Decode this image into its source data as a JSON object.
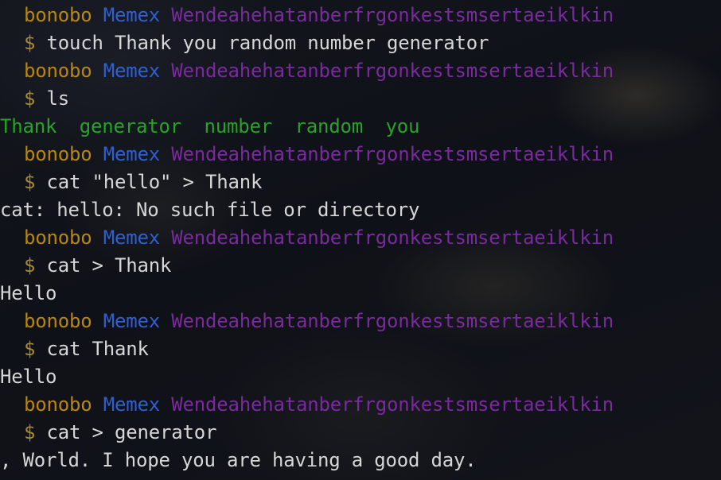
{
  "prompt": {
    "user": "bonobo",
    "host": "Memex",
    "path": "Wendeahehatanberfrgonkestsmsertaeiklkin",
    "symbol": "$"
  },
  "blocks": [
    {
      "command": "touch Thank you random number generator",
      "output": []
    },
    {
      "command": "ls",
      "ls_output": [
        "Thank",
        "generator",
        "number",
        "random",
        "you"
      ]
    },
    {
      "command": "cat \"hello\" > Thank",
      "output": [
        "cat: hello: No such file or directory"
      ]
    },
    {
      "command": "cat > Thank",
      "output": [
        "Hello"
      ]
    },
    {
      "command": "cat Thank",
      "output": [
        "Hello"
      ]
    },
    {
      "command": "cat > generator",
      "output": [
        ", World. I hope you are having a good day."
      ]
    }
  ],
  "colors": {
    "user": "#b8860b",
    "host": "#2f5fd0",
    "path": "#7a2a9e",
    "ls_output": "#27a327",
    "text": "#d6d6d6"
  }
}
